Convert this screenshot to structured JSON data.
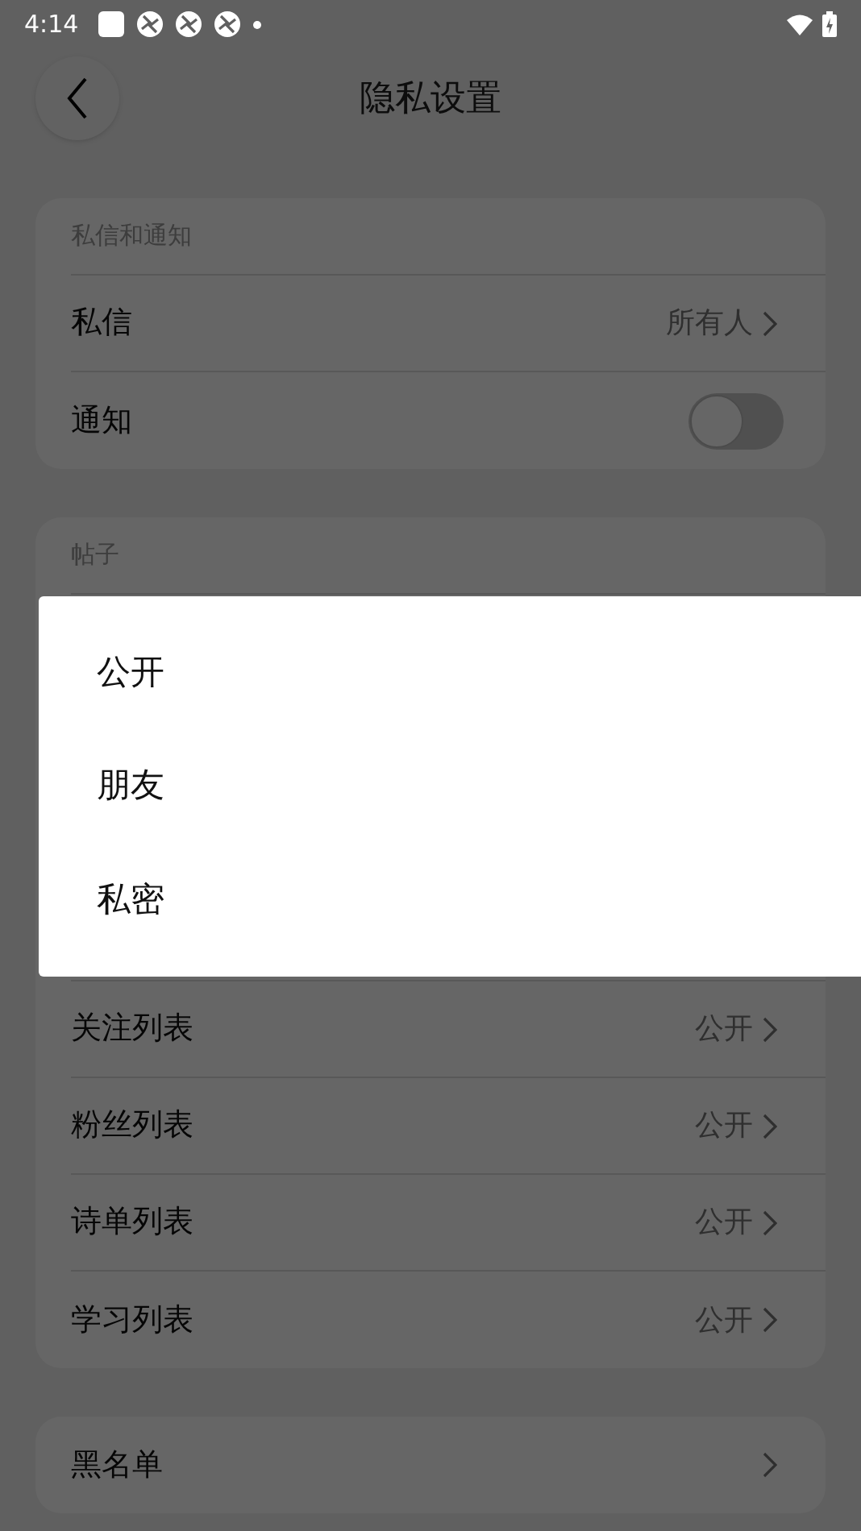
{
  "status_bar": {
    "time": "4:14"
  },
  "header": {
    "title": "隐私设置"
  },
  "sections": [
    {
      "title": "私信和通知",
      "rows": [
        {
          "kind": "link",
          "label": "私信",
          "value": "所有人"
        },
        {
          "kind": "toggle",
          "label": "通知",
          "on": false
        }
      ]
    },
    {
      "title": "帖子",
      "rows": [
        {
          "kind": "link",
          "label": "关注列表",
          "value": "公开"
        },
        {
          "kind": "link",
          "label": "粉丝列表",
          "value": "公开"
        },
        {
          "kind": "link",
          "label": "诗单列表",
          "value": "公开"
        },
        {
          "kind": "link",
          "label": "学习列表",
          "value": "公开"
        }
      ]
    },
    {
      "rows": [
        {
          "kind": "link",
          "label": "黑名单"
        }
      ]
    }
  ],
  "dialog": {
    "options": [
      {
        "label": "公开"
      },
      {
        "label": "朋友"
      },
      {
        "label": "私密"
      }
    ]
  }
}
